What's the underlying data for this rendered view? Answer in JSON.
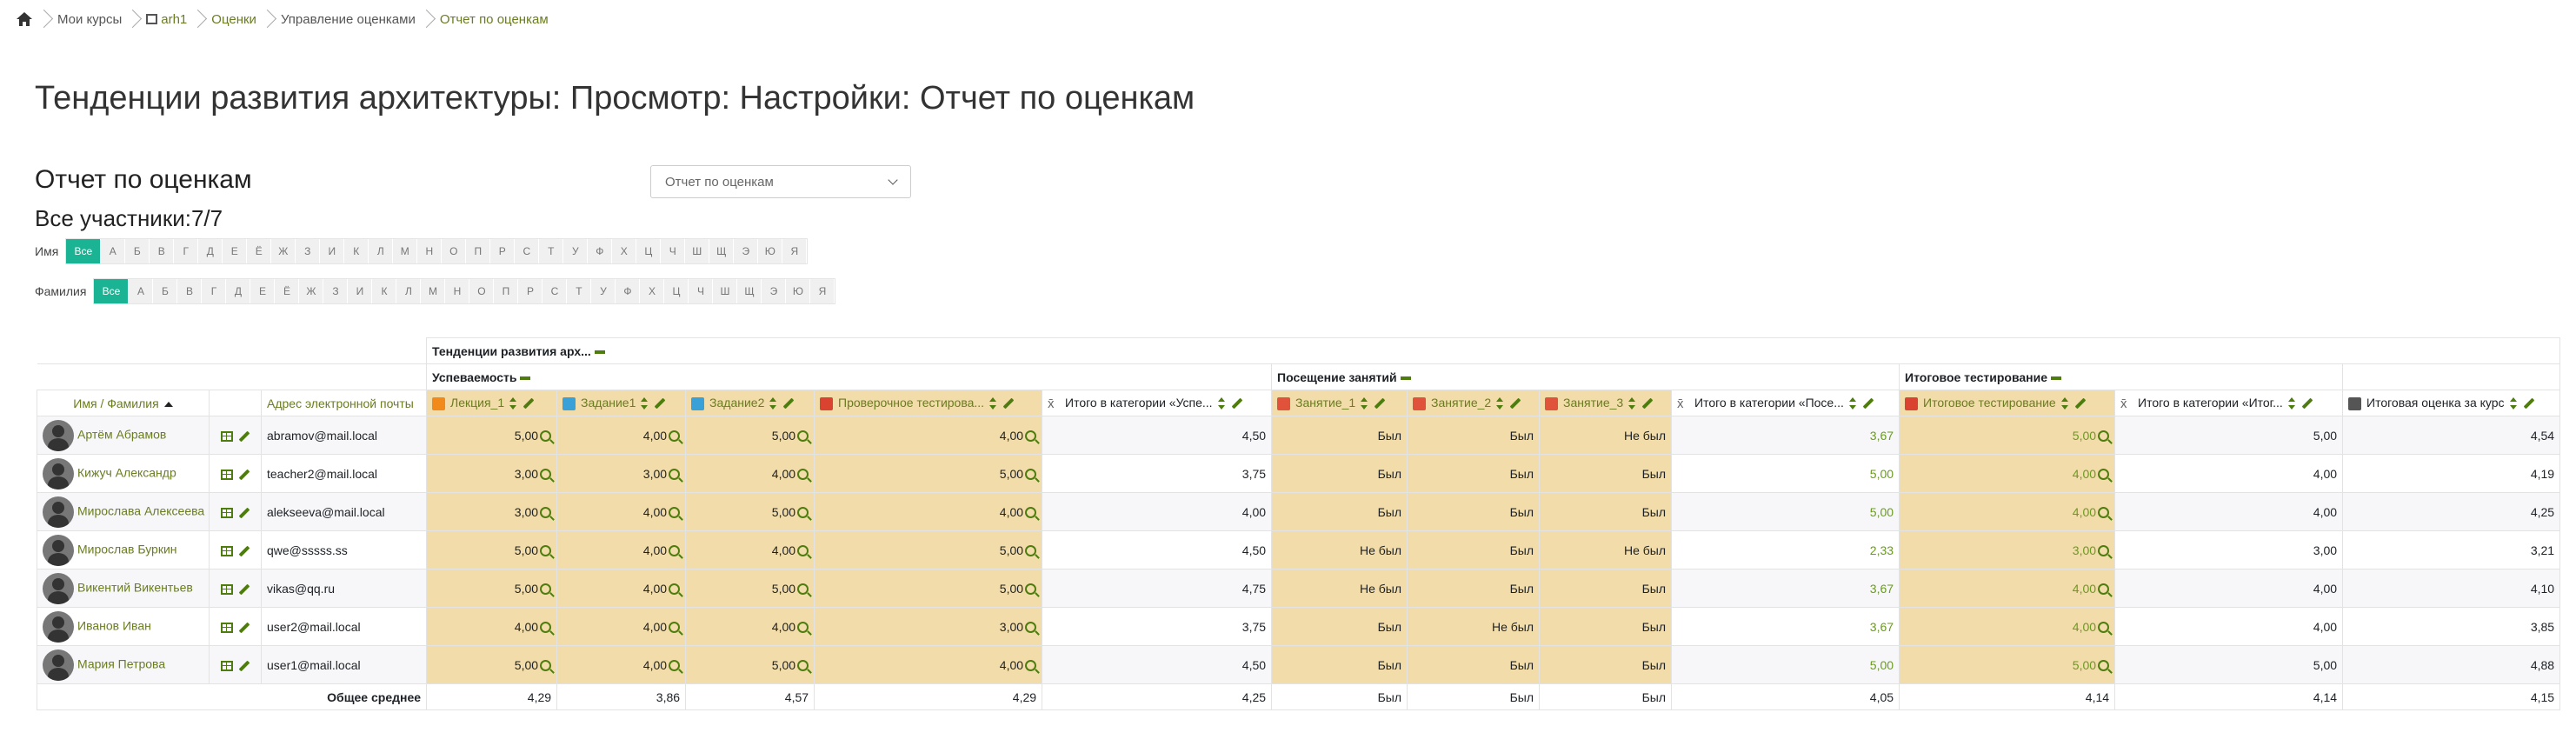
{
  "breadcrumb": [
    "Мои курсы",
    "arh1",
    "Оценки",
    "Управление оценками",
    "Отчет по оценкам"
  ],
  "page_title": "Тенденции развития архитектуры: Просмотр: Настройки: Отчет по оценкам",
  "report_title": "Отчет по оценкам",
  "participants": "Все участники:7/7",
  "report_select": "Отчет по оценкам",
  "firstname_label": "Имя",
  "lastname_label": "Фамилия",
  "initials_all": "Все",
  "initials": [
    "А",
    "Б",
    "В",
    "Г",
    "Д",
    "Е",
    "Ё",
    "Ж",
    "З",
    "И",
    "К",
    "Л",
    "М",
    "Н",
    "О",
    "П",
    "Р",
    "С",
    "Т",
    "У",
    "Ф",
    "Х",
    "Ц",
    "Ч",
    "Ш",
    "Щ",
    "Э",
    "Ю",
    "Я"
  ],
  "groups": {
    "course": "Тенденции развития арх...",
    "cat1": "Успеваемость",
    "cat2": "Посещение занятий",
    "cat3": "Итоговое тестирование"
  },
  "columns": {
    "name": "Имя / Фамилия",
    "email": "Адрес электронной почты",
    "lec1": "Лекция_1",
    "z1": "Задание1",
    "z2": "Задание2",
    "quiz": "Проверочное тестирова...",
    "tot1": "Итого в категории «Успе...",
    "att1": "Занятие_1",
    "att2": "Занятие_2",
    "att3": "Занятие_3",
    "tot2": "Итого в категории «Посе...",
    "final": "Итоговое тестирование",
    "tot3": "Итого в категории «Итог...",
    "course_total": "Итоговая оценка за курс"
  },
  "rows": [
    {
      "name": "Артём Абрамов",
      "email": "abramov@mail.local",
      "c": [
        "5,00",
        "4,00",
        "5,00",
        "4,00",
        "4,50",
        "Был",
        "Был",
        "Не был",
        "3,67",
        "5,00",
        "5,00",
        "4,54"
      ]
    },
    {
      "name": "Кижуч Александр",
      "email": "teacher2@mail.local",
      "c": [
        "3,00",
        "3,00",
        "4,00",
        "5,00",
        "3,75",
        "Был",
        "Был",
        "Был",
        "5,00",
        "4,00",
        "4,00",
        "4,19"
      ]
    },
    {
      "name": "Мирослава Алексеева",
      "email": "alekseeva@mail.local",
      "c": [
        "3,00",
        "4,00",
        "5,00",
        "4,00",
        "4,00",
        "Был",
        "Был",
        "Был",
        "5,00",
        "4,00",
        "4,00",
        "4,25"
      ]
    },
    {
      "name": "Мирослав Буркин",
      "email": "qwe@sssss.ss",
      "c": [
        "5,00",
        "4,00",
        "4,00",
        "5,00",
        "4,50",
        "Не был",
        "Был",
        "Не был",
        "2,33",
        "3,00",
        "3,00",
        "3,21"
      ]
    },
    {
      "name": "Викентий Викентьев",
      "email": "vikas@qq.ru",
      "c": [
        "5,00",
        "4,00",
        "5,00",
        "5,00",
        "4,75",
        "Не был",
        "Был",
        "Был",
        "3,67",
        "4,00",
        "4,00",
        "4,10"
      ]
    },
    {
      "name": "Иванов Иван",
      "email": "user2@mail.local",
      "c": [
        "4,00",
        "4,00",
        "4,00",
        "3,00",
        "3,75",
        "Был",
        "Не был",
        "Был",
        "3,67",
        "4,00",
        "4,00",
        "3,85"
      ]
    },
    {
      "name": "Мария Петрова",
      "email": "user1@mail.local",
      "c": [
        "5,00",
        "4,00",
        "5,00",
        "4,00",
        "4,50",
        "Был",
        "Был",
        "Был",
        "5,00",
        "5,00",
        "5,00",
        "4,88"
      ]
    }
  ],
  "average": {
    "label": "Общее среднее",
    "c": [
      "4,29",
      "3,86",
      "4,57",
      "4,29",
      "4,25",
      "Был",
      "Был",
      "Был",
      "4,05",
      "4,14",
      "4,14",
      "4,15"
    ]
  }
}
